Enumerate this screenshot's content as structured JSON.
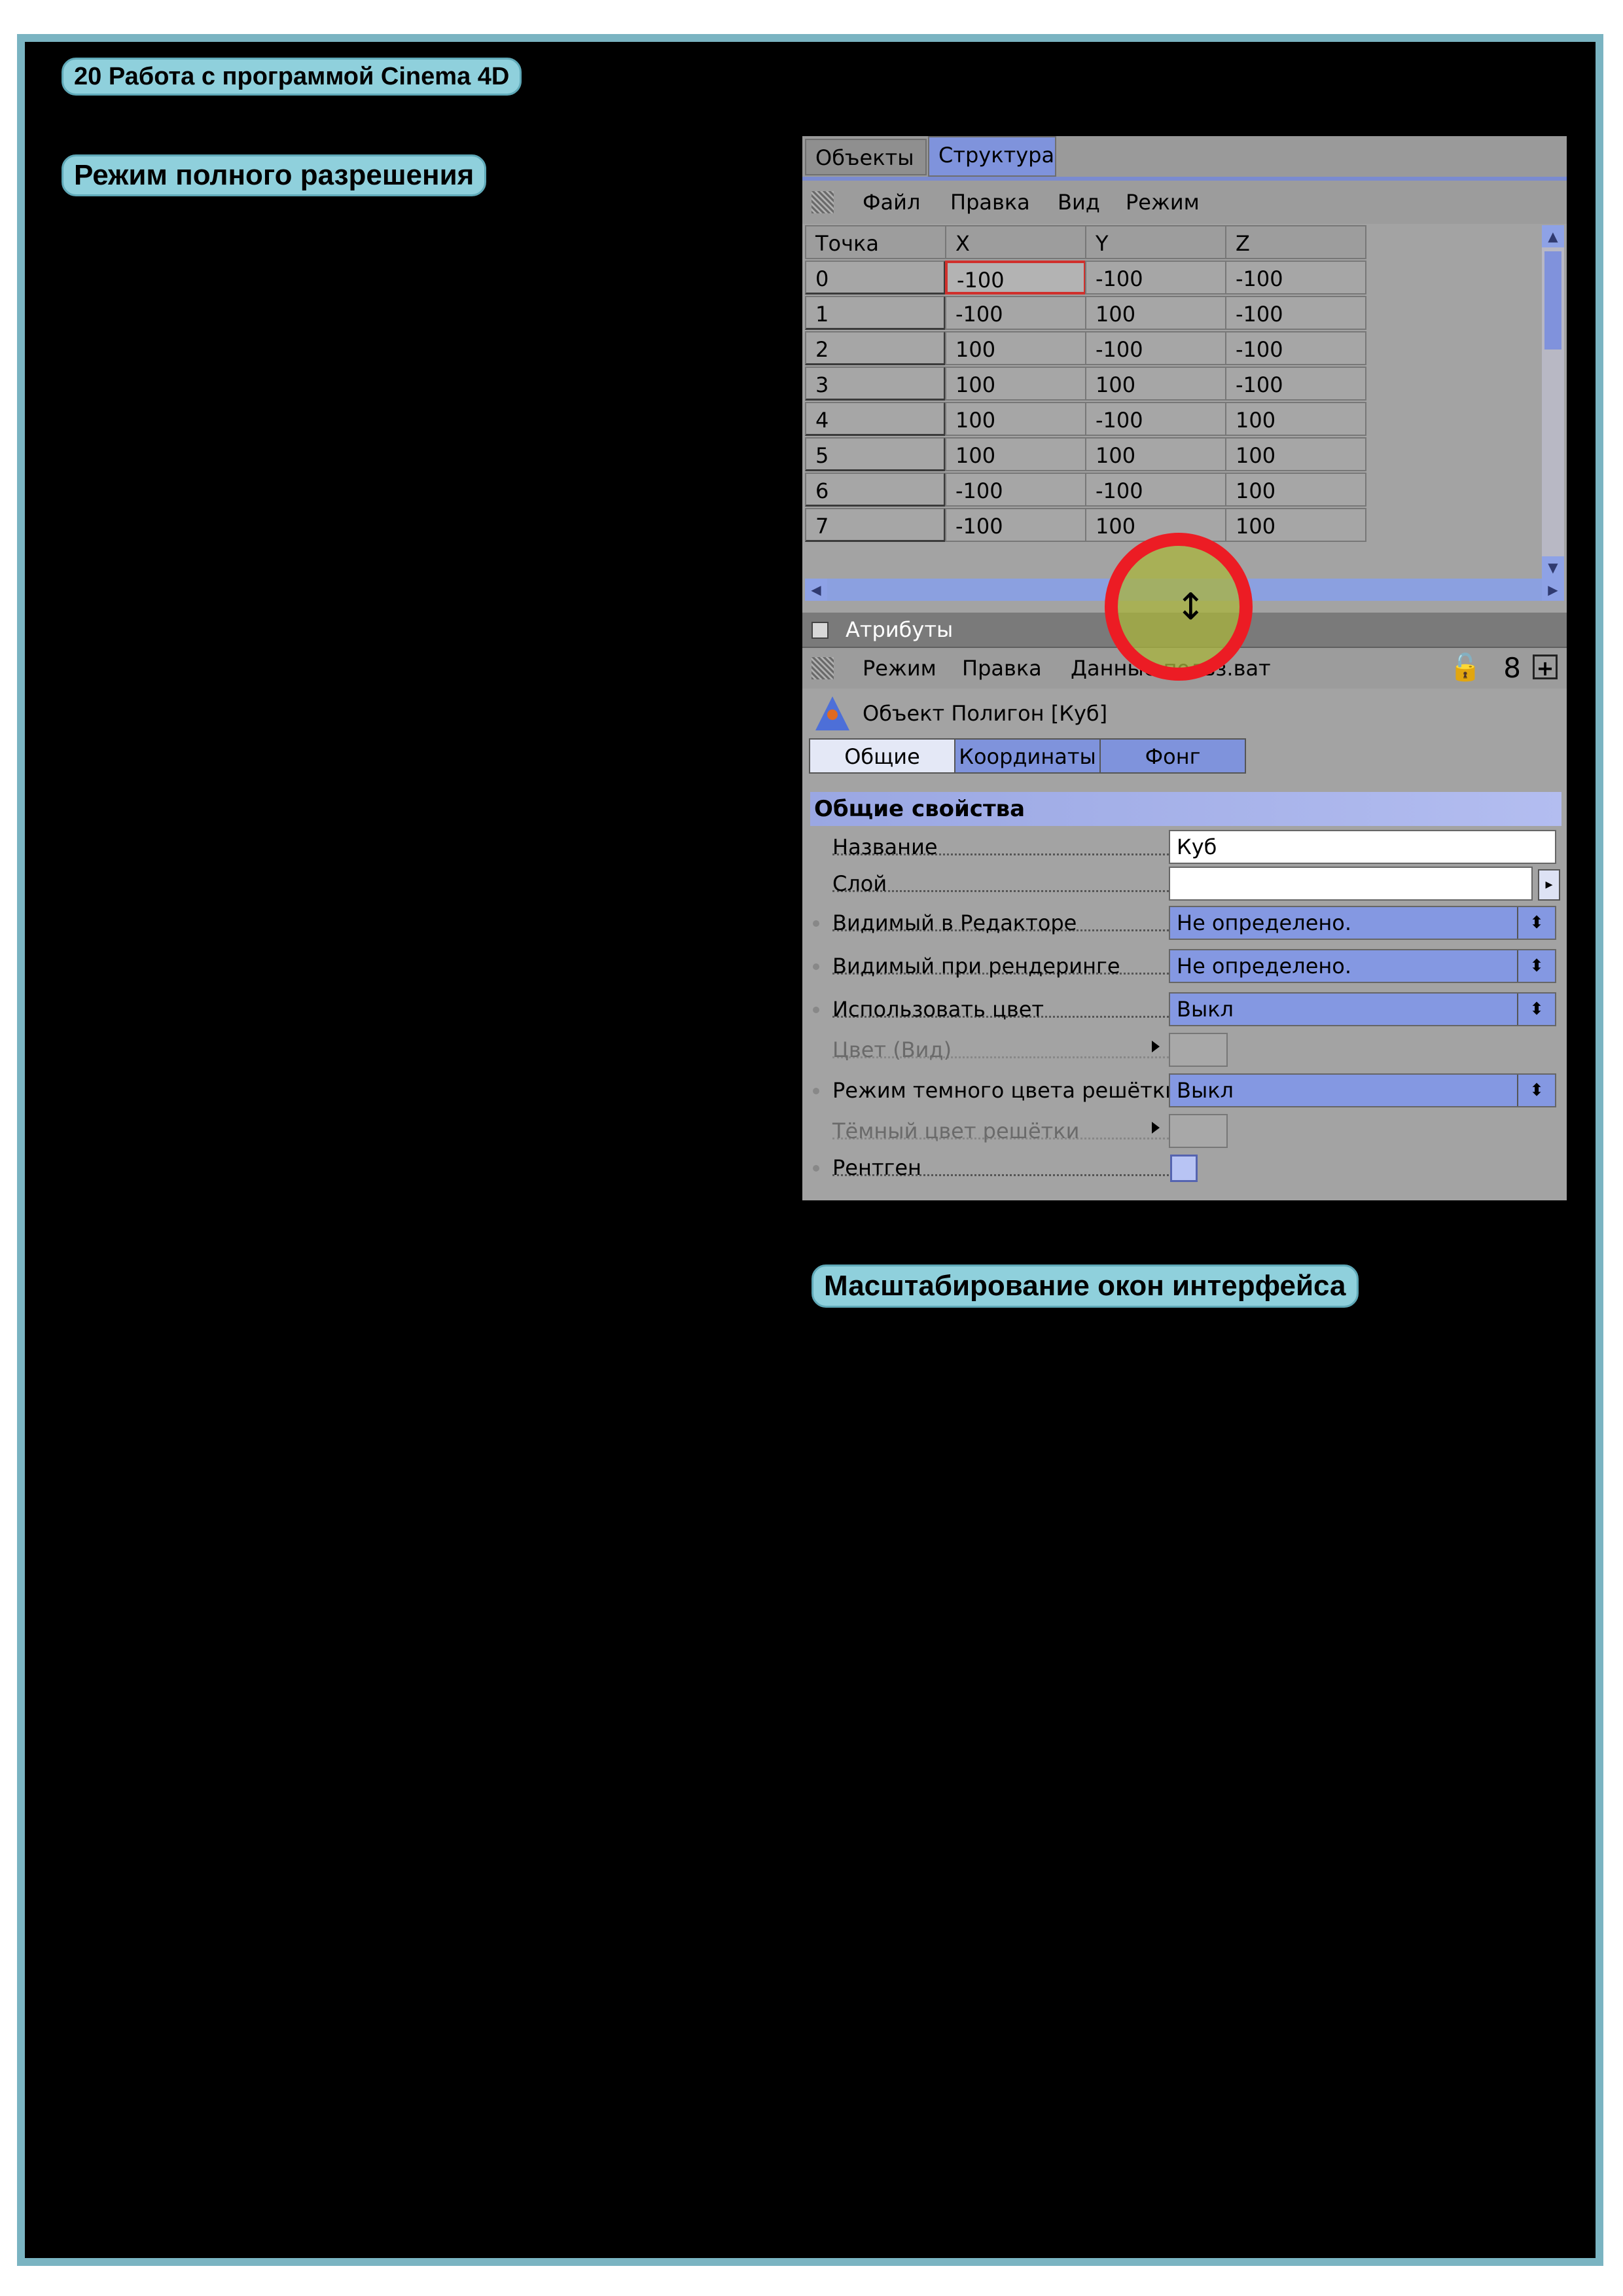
{
  "page": {
    "header": "20 Работа с программой Cinema 4D",
    "section1": "Режим полного разрешения",
    "section2": "Масштабирование окон интерфейса"
  },
  "structure": {
    "tabs": [
      "Объекты",
      "Структура"
    ],
    "menu": [
      "Файл",
      "Правка",
      "Вид",
      "Режим"
    ],
    "columns": [
      "Точка",
      "X",
      "Y",
      "Z"
    ],
    "rows": [
      [
        "0",
        "-100",
        "-100",
        "-100"
      ],
      [
        "1",
        "-100",
        "100",
        "-100"
      ],
      [
        "2",
        "100",
        "-100",
        "-100"
      ],
      [
        "3",
        "100",
        "100",
        "-100"
      ],
      [
        "4",
        "100",
        "-100",
        "100"
      ],
      [
        "5",
        "100",
        "100",
        "100"
      ],
      [
        "6",
        "-100",
        "-100",
        "100"
      ],
      [
        "7",
        "-100",
        "100",
        "100"
      ]
    ]
  },
  "attributes": {
    "title": "Атрибуты",
    "menu": [
      "Режим",
      "Правка",
      "Данные польз.ват"
    ],
    "object_title": "Объект Полигон [Куб]",
    "tabs": [
      "Общие",
      "Координаты",
      "Фонг"
    ],
    "section": "Общие свойства",
    "props": {
      "name_label": "Название",
      "name_value": "Куб",
      "layer_label": "Слой",
      "layer_value": "",
      "vis_editor_label": "Видимый в Редакторе",
      "vis_editor_value": "Не определено.",
      "vis_render_label": "Видимый при рендеринге",
      "vis_render_value": "Не определено.",
      "use_color_label": "Использовать цвет",
      "use_color_value": "Выкл",
      "color_view_label": "Цвет (Вид)",
      "dark_mode_label": "Режим темного цвета решётки",
      "dark_mode_value": "Выкл",
      "dark_color_label": "Тёмный цвет решётки",
      "xray_label": "Рентген"
    }
  },
  "icons": {
    "grip": "grip-icon",
    "object": "polygon-object-icon",
    "lock": "lock-icon",
    "cursor": "resize-vertical-cursor-icon"
  },
  "colors": {
    "accent": "#7f93dc",
    "highlight_ring": "#ec1c24",
    "pill": "#8fd0dc"
  }
}
